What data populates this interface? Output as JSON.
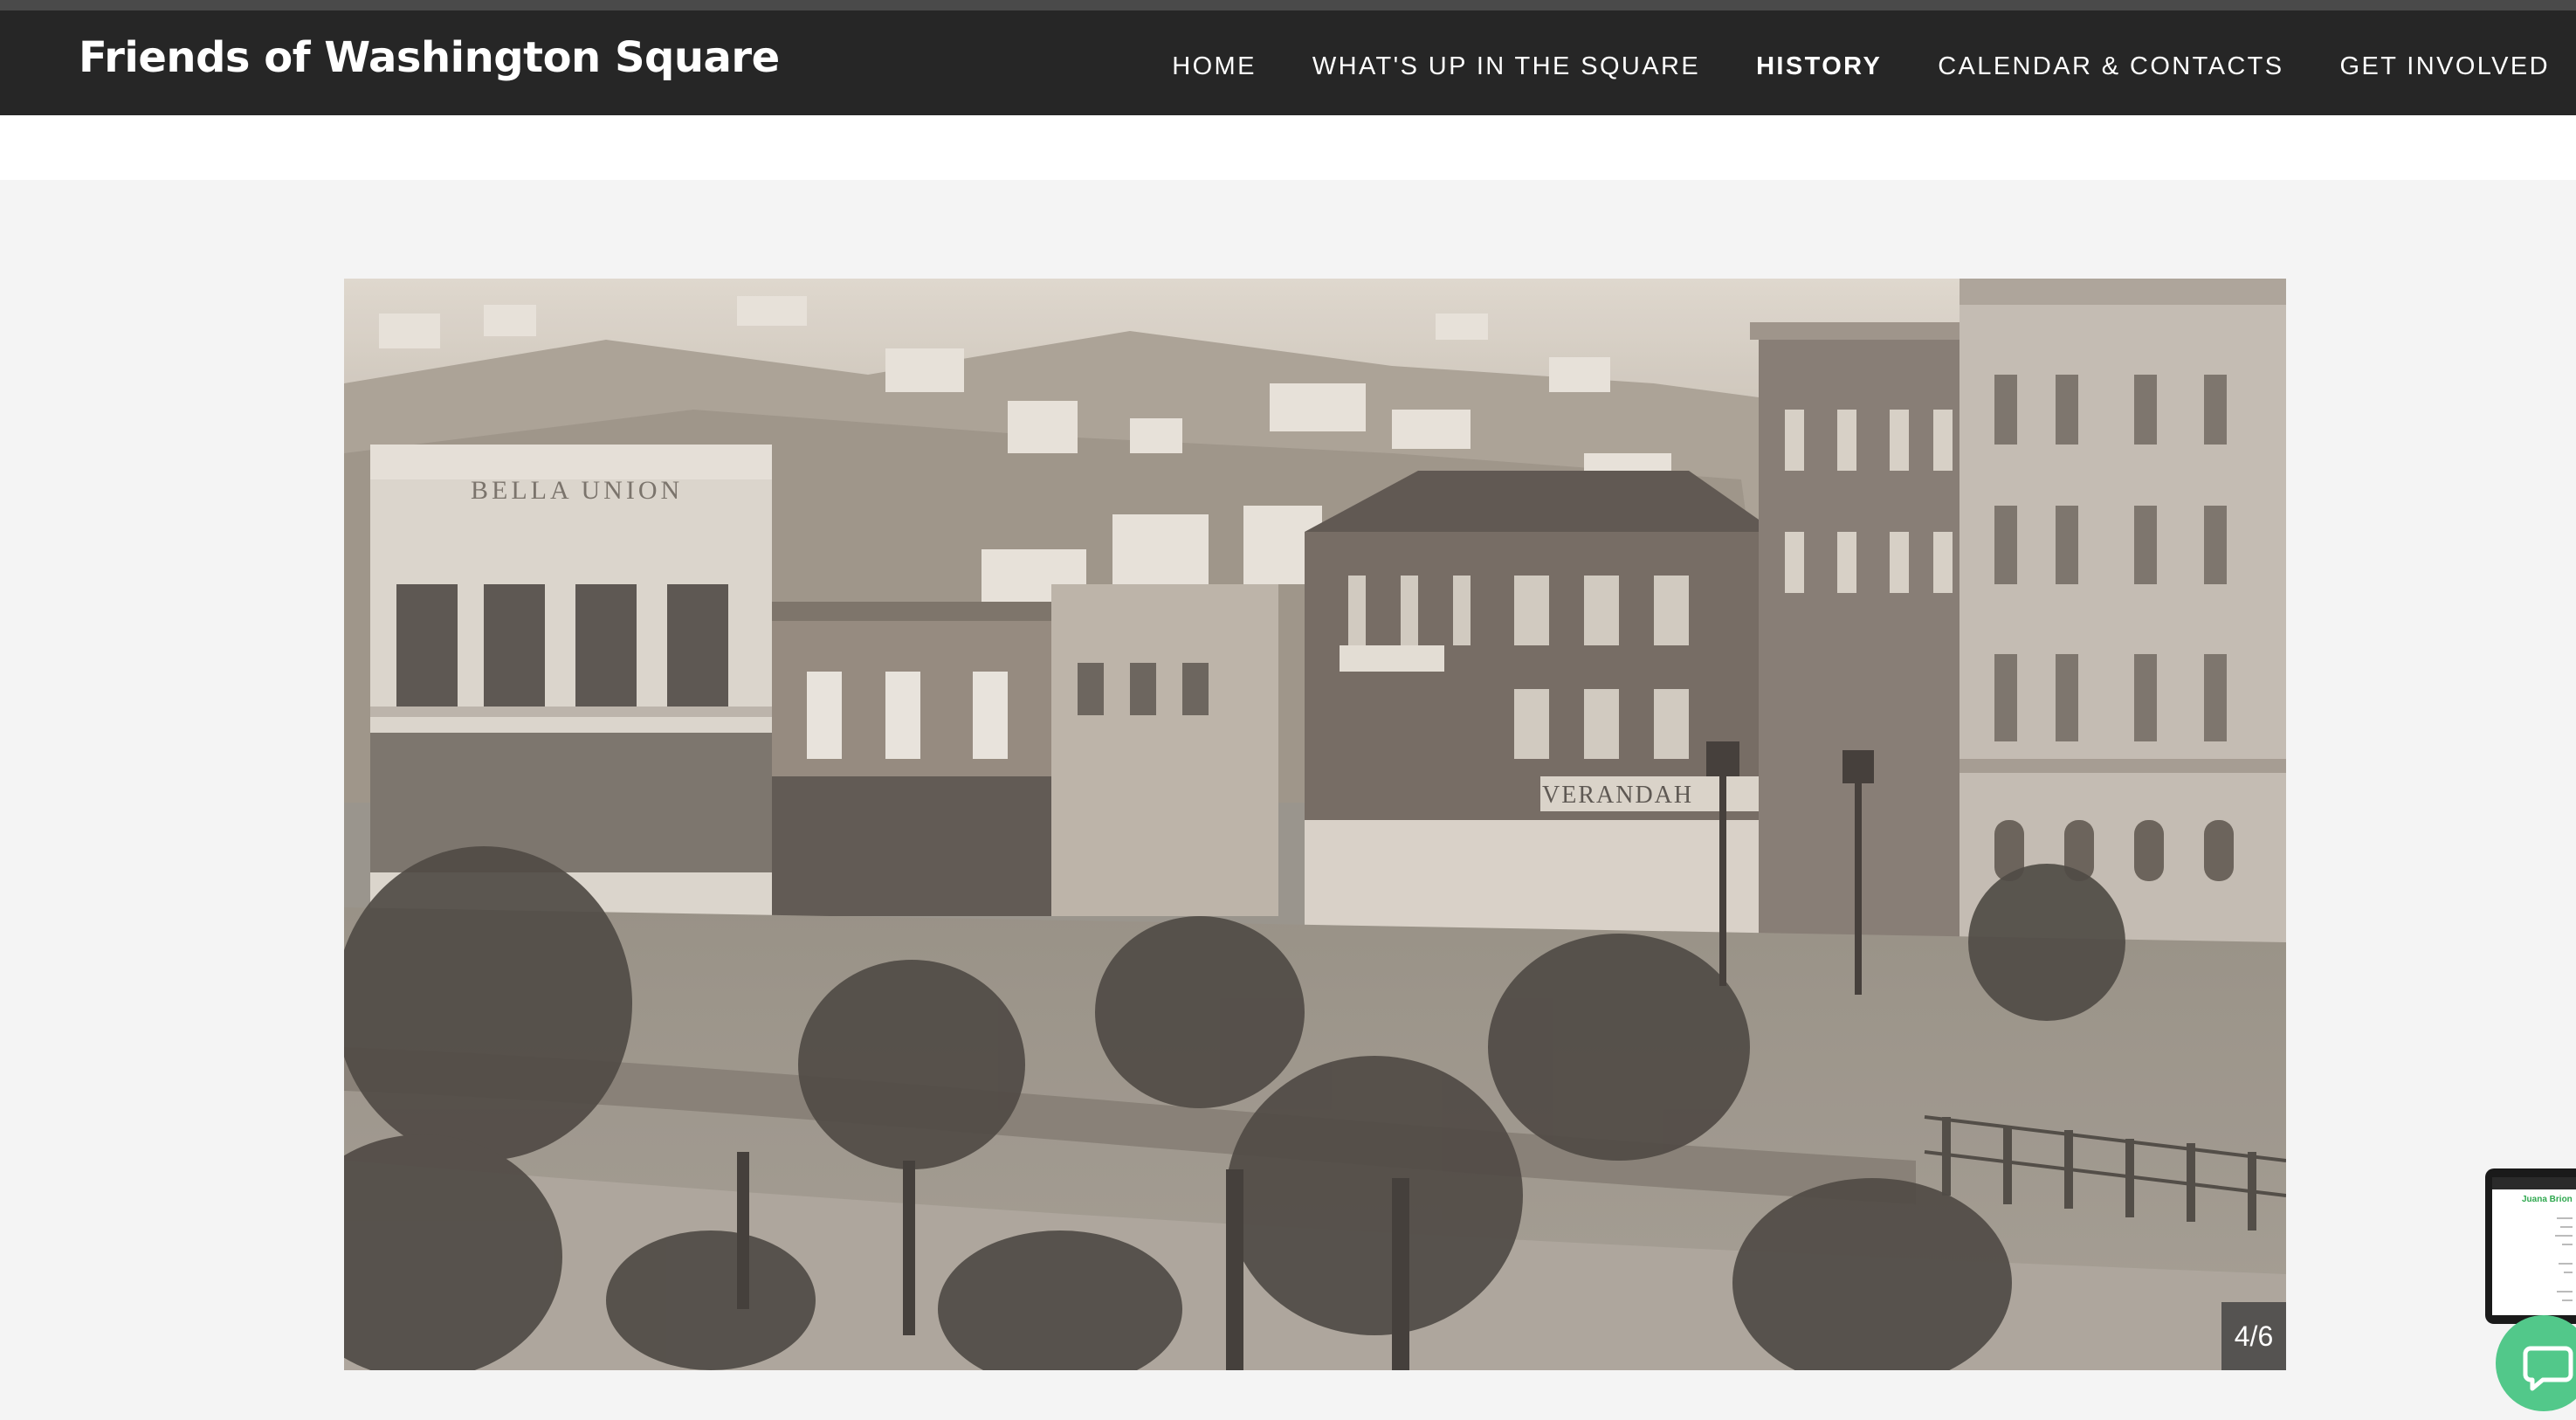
{
  "header": {
    "site_title": "Friends of Washington Square",
    "nav": [
      {
        "label": "HOME",
        "active": false
      },
      {
        "label": "WHAT'S UP IN THE SQUARE",
        "active": false
      },
      {
        "label": "HISTORY",
        "active": true
      },
      {
        "label": "CALENDAR & CONTACTS",
        "active": false
      },
      {
        "label": "GET INVOLVED",
        "active": false
      }
    ]
  },
  "slideshow": {
    "counter": "4/6",
    "photo_signs": {
      "bella_union": "BELLA UNION",
      "verandah": "VERANDAH"
    }
  },
  "preview_thumbnail": {
    "title": "Juana Brion"
  },
  "colors": {
    "navbar_bg": "#262626",
    "page_bg": "#f4f4f4",
    "chat_green": "#52c88a",
    "thumb_title_green": "#2fa84f"
  },
  "icons": {
    "chat": "chat-bubble-icon"
  }
}
